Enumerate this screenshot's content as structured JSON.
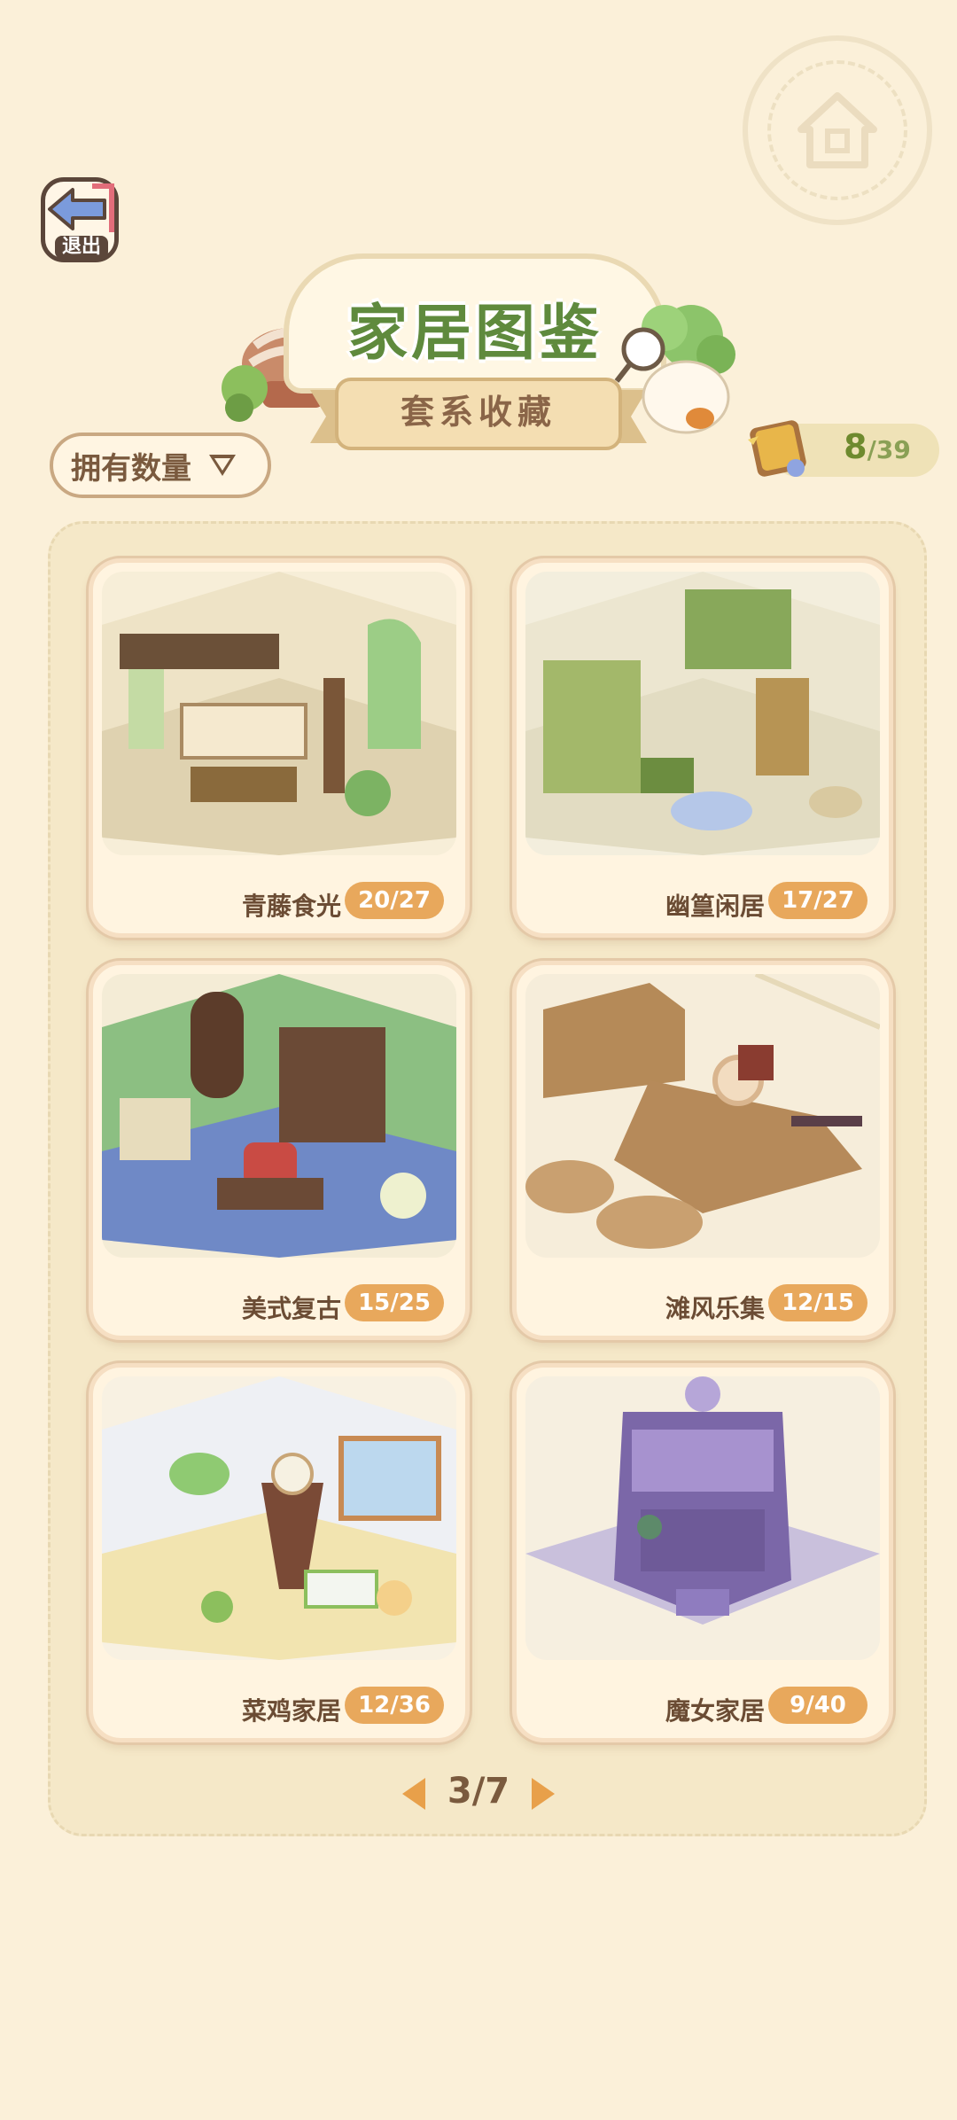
{
  "header": {
    "exit_label": "退出",
    "title": "家居图鉴",
    "subtitle": "套系收藏"
  },
  "sort": {
    "label": "拥有数量"
  },
  "counter": {
    "owned": "8",
    "total": "/39"
  },
  "sets": [
    {
      "name": "青藤食光",
      "progress": "20/27"
    },
    {
      "name": "幽篁闲居",
      "progress": "17/27"
    },
    {
      "name": "美式复古",
      "progress": "15/25"
    },
    {
      "name": "滩风乐集",
      "progress": "12/15"
    },
    {
      "name": "菜鸡家居",
      "progress": "12/36"
    },
    {
      "name": "魔女家居",
      "progress": "9/40"
    }
  ],
  "pager": {
    "label": "3/7"
  },
  "colors": {
    "background": "#fbf0d9",
    "title_green": "#5f8a3d",
    "badge_orange": "#e8a85c",
    "accent_arrow": "#e8a04a"
  },
  "icons": [
    "home-icon",
    "exit-arrow-icon",
    "sort-triangle-icon",
    "book-icon",
    "prev-arrow-icon",
    "next-arrow-icon"
  ]
}
